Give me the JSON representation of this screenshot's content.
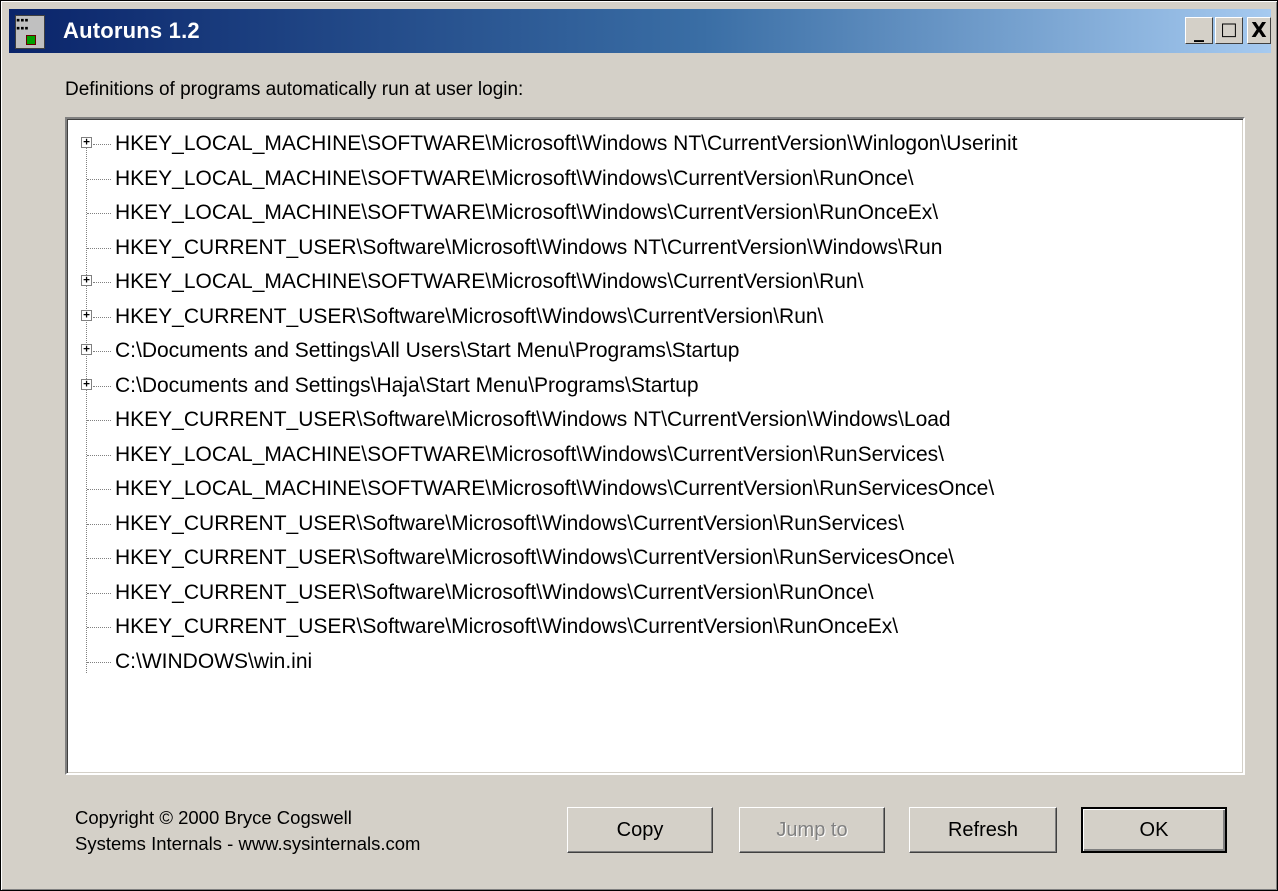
{
  "window": {
    "title": "Autoruns 1.2"
  },
  "controls": {
    "minimize": "_",
    "maximize": "□",
    "close": "X"
  },
  "description": "Definitions of programs automatically run at user login:",
  "tree": {
    "items": [
      {
        "label": "HKEY_LOCAL_MACHINE\\SOFTWARE\\Microsoft\\Windows NT\\CurrentVersion\\Winlogon\\Userinit",
        "expandable": true
      },
      {
        "label": "HKEY_LOCAL_MACHINE\\SOFTWARE\\Microsoft\\Windows\\CurrentVersion\\RunOnce\\",
        "expandable": false
      },
      {
        "label": "HKEY_LOCAL_MACHINE\\SOFTWARE\\Microsoft\\Windows\\CurrentVersion\\RunOnceEx\\",
        "expandable": false
      },
      {
        "label": "HKEY_CURRENT_USER\\Software\\Microsoft\\Windows NT\\CurrentVersion\\Windows\\Run",
        "expandable": false
      },
      {
        "label": "HKEY_LOCAL_MACHINE\\SOFTWARE\\Microsoft\\Windows\\CurrentVersion\\Run\\",
        "expandable": true
      },
      {
        "label": "HKEY_CURRENT_USER\\Software\\Microsoft\\Windows\\CurrentVersion\\Run\\",
        "expandable": true
      },
      {
        "label": "C:\\Documents and Settings\\All Users\\Start Menu\\Programs\\Startup",
        "expandable": true
      },
      {
        "label": "C:\\Documents and Settings\\Haja\\Start Menu\\Programs\\Startup",
        "expandable": true
      },
      {
        "label": "HKEY_CURRENT_USER\\Software\\Microsoft\\Windows NT\\CurrentVersion\\Windows\\Load",
        "expandable": false
      },
      {
        "label": "HKEY_LOCAL_MACHINE\\SOFTWARE\\Microsoft\\Windows\\CurrentVersion\\RunServices\\",
        "expandable": false
      },
      {
        "label": "HKEY_LOCAL_MACHINE\\SOFTWARE\\Microsoft\\Windows\\CurrentVersion\\RunServicesOnce\\",
        "expandable": false
      },
      {
        "label": "HKEY_CURRENT_USER\\Software\\Microsoft\\Windows\\CurrentVersion\\RunServices\\",
        "expandable": false
      },
      {
        "label": "HKEY_CURRENT_USER\\Software\\Microsoft\\Windows\\CurrentVersion\\RunServicesOnce\\",
        "expandable": false
      },
      {
        "label": "HKEY_CURRENT_USER\\Software\\Microsoft\\Windows\\CurrentVersion\\RunOnce\\",
        "expandable": false
      },
      {
        "label": "HKEY_CURRENT_USER\\Software\\Microsoft\\Windows\\CurrentVersion\\RunOnceEx\\",
        "expandable": false
      },
      {
        "label": "C:\\WINDOWS\\win.ini",
        "expandable": false
      }
    ]
  },
  "footer": {
    "copyright_line1": "Copyright © 2000 Bryce Cogswell",
    "copyright_line2": "Systems Internals - www.sysinternals.com"
  },
  "buttons": {
    "copy": "Copy",
    "jump_to": "Jump to",
    "refresh": "Refresh",
    "ok": "OK"
  }
}
